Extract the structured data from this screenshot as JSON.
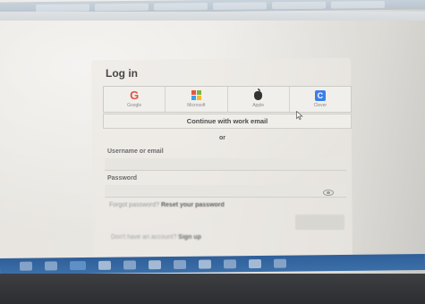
{
  "login": {
    "title": "Log in",
    "providers": [
      {
        "label": "Google",
        "icon": "google-icon"
      },
      {
        "label": "Microsoft",
        "icon": "microsoft-icon"
      },
      {
        "label": "Apple",
        "icon": "apple-icon"
      },
      {
        "label": "Clever",
        "icon": "clever-icon"
      }
    ],
    "work_email_label": "Continue with work email",
    "divider": "or",
    "username_label": "Username or email",
    "password_label": "Password",
    "forgot_prefix": "Forgot password?",
    "forgot_link": "Reset your password",
    "signup_prefix": "Don't have an account?",
    "signup_link": "Sign up"
  },
  "colors": {
    "google": "#de5341",
    "clever": "#3d7ee8",
    "taskbar": "#2f5f9a"
  },
  "taskbar": {
    "icons": [
      "start-icon",
      "explorer-icon",
      "browser-icon",
      "mail-icon",
      "chrome-icon",
      "files-icon",
      "settings-icon",
      "store-icon",
      "word-icon",
      "app-icon",
      "network-icon"
    ]
  }
}
